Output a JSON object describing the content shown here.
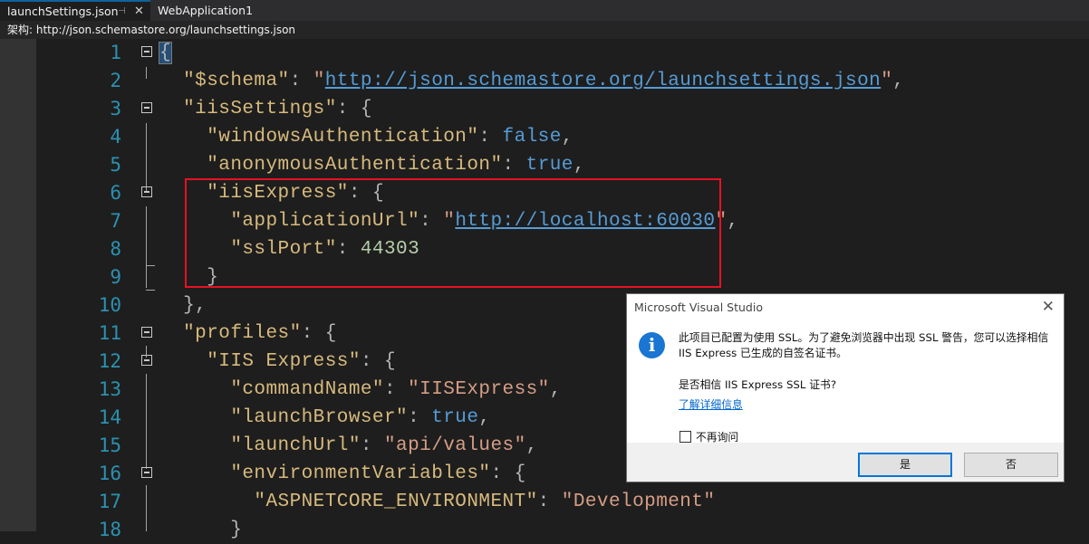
{
  "tabs": {
    "active_label": "launchSettings.json",
    "pin_icon": "pin-icon",
    "close_icon": "close-icon",
    "inactive_label": "WebApplication1"
  },
  "schema_bar": {
    "text": "架构: http://json.schemastore.org/launchsettings.json"
  },
  "editor": {
    "lines": [
      {
        "num": "1"
      },
      {
        "num": "2",
        "key": "\"$schema\"",
        "url": "http://json.schemastore.org/launchsettings.json"
      },
      {
        "num": "3",
        "key": "\"iisSettings\""
      },
      {
        "num": "4",
        "key": "\"windowsAuthentication\"",
        "value": "false"
      },
      {
        "num": "5",
        "key": "\"anonymousAuthentication\"",
        "value": "true"
      },
      {
        "num": "6",
        "key": "\"iisExpress\""
      },
      {
        "num": "7",
        "key": "\"applicationUrl\"",
        "url": "http://localhost:60030"
      },
      {
        "num": "8",
        "key": "\"sslPort\"",
        "value": "44303"
      },
      {
        "num": "9"
      },
      {
        "num": "10"
      },
      {
        "num": "11",
        "key": "\"profiles\""
      },
      {
        "num": "12",
        "key": "\"IIS Express\""
      },
      {
        "num": "13",
        "key": "\"commandName\"",
        "value": "\"IISExpress\""
      },
      {
        "num": "14",
        "key": "\"launchBrowser\"",
        "value": "true"
      },
      {
        "num": "15",
        "key": "\"launchUrl\"",
        "value": "\"api/values\""
      },
      {
        "num": "16",
        "key": "\"environmentVariables\""
      },
      {
        "num": "17",
        "key": "\"ASPNETCORE_ENVIRONMENT\"",
        "value": "\"Development\""
      },
      {
        "num": "18"
      }
    ]
  },
  "dialog": {
    "title": "Microsoft Visual Studio",
    "close_icon": "close-icon",
    "icon": "info-icon",
    "icon_glyph": "i",
    "message_line1": "此项目已配置为使用 SSL。为了避免浏览器中出现 SSL 警告，您可以选择相信",
    "message_line2": "IIS Express 已生成的自签名证书。",
    "question": "是否相信 IIS Express SSL 证书?",
    "link": "了解详细信息",
    "checkbox_label": "不再询问",
    "yes_button": "是",
    "no_button": "否"
  },
  "colors": {
    "editor_bg": "#1e1e1e",
    "line_number": "#2b91af",
    "json_key": "#d7ba7d",
    "json_string": "#d69d85",
    "json_keyword": "#569cd6",
    "json_number": "#b5cea8",
    "highlight_box": "#e81123",
    "dialog_info": "#1976d2"
  }
}
